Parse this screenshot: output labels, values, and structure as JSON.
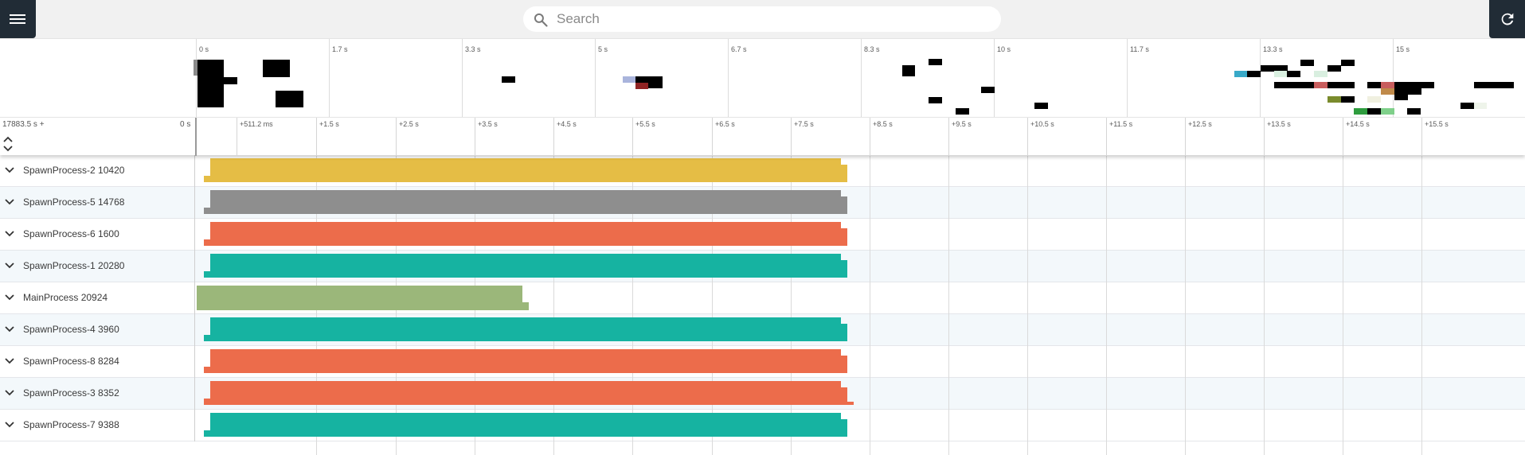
{
  "header": {
    "menu_icon": "hamburger-menu-icon",
    "search_placeholder": "Search",
    "search_value": "",
    "search_icon": "search-icon",
    "reload_icon": "reload-icon"
  },
  "overview": {
    "tick_labels": [
      "0 s",
      "1.7 s",
      "3.3 s",
      "5 s",
      "6.7 s",
      "8.3 s",
      "10 s",
      "11.7 s",
      "13.3 s",
      "15 s"
    ]
  },
  "timeline": {
    "offset_label": "17883.5 s +",
    "zero_label": "0 s",
    "tick_labels": [
      "+511.2 ms",
      "+1.5 s",
      "+2.5 s",
      "+3.5 s",
      "+4.5 s",
      "+5.5 s",
      "+6.5 s",
      "+7.5 s",
      "+8.5 s",
      "+9.5 s",
      "+10.5 s",
      "+11.5 s",
      "+12.5 s",
      "+13.5 s",
      "+14.5 s",
      "+15.5 s"
    ],
    "expand_icon": "expand-collapse-icon"
  },
  "tracks": [
    {
      "name": "SpawnProcess-2 10420",
      "color": "#e5bd45"
    },
    {
      "name": "SpawnProcess-5 14768",
      "color": "#8e8e8e"
    },
    {
      "name": "SpawnProcess-6 1600",
      "color": "#ec6c4b"
    },
    {
      "name": "SpawnProcess-1 20280",
      "color": "#16b3a1"
    },
    {
      "name": "MainProcess 20924",
      "color": "#9bb77a"
    },
    {
      "name": "SpawnProcess-4 3960",
      "color": "#16b3a1"
    },
    {
      "name": "SpawnProcess-8 8284",
      "color": "#ec6c4b"
    },
    {
      "name": "SpawnProcess-3 8352",
      "color": "#ec6c4b"
    },
    {
      "name": "SpawnProcess-7 9388",
      "color": "#16b3a1"
    }
  ]
}
